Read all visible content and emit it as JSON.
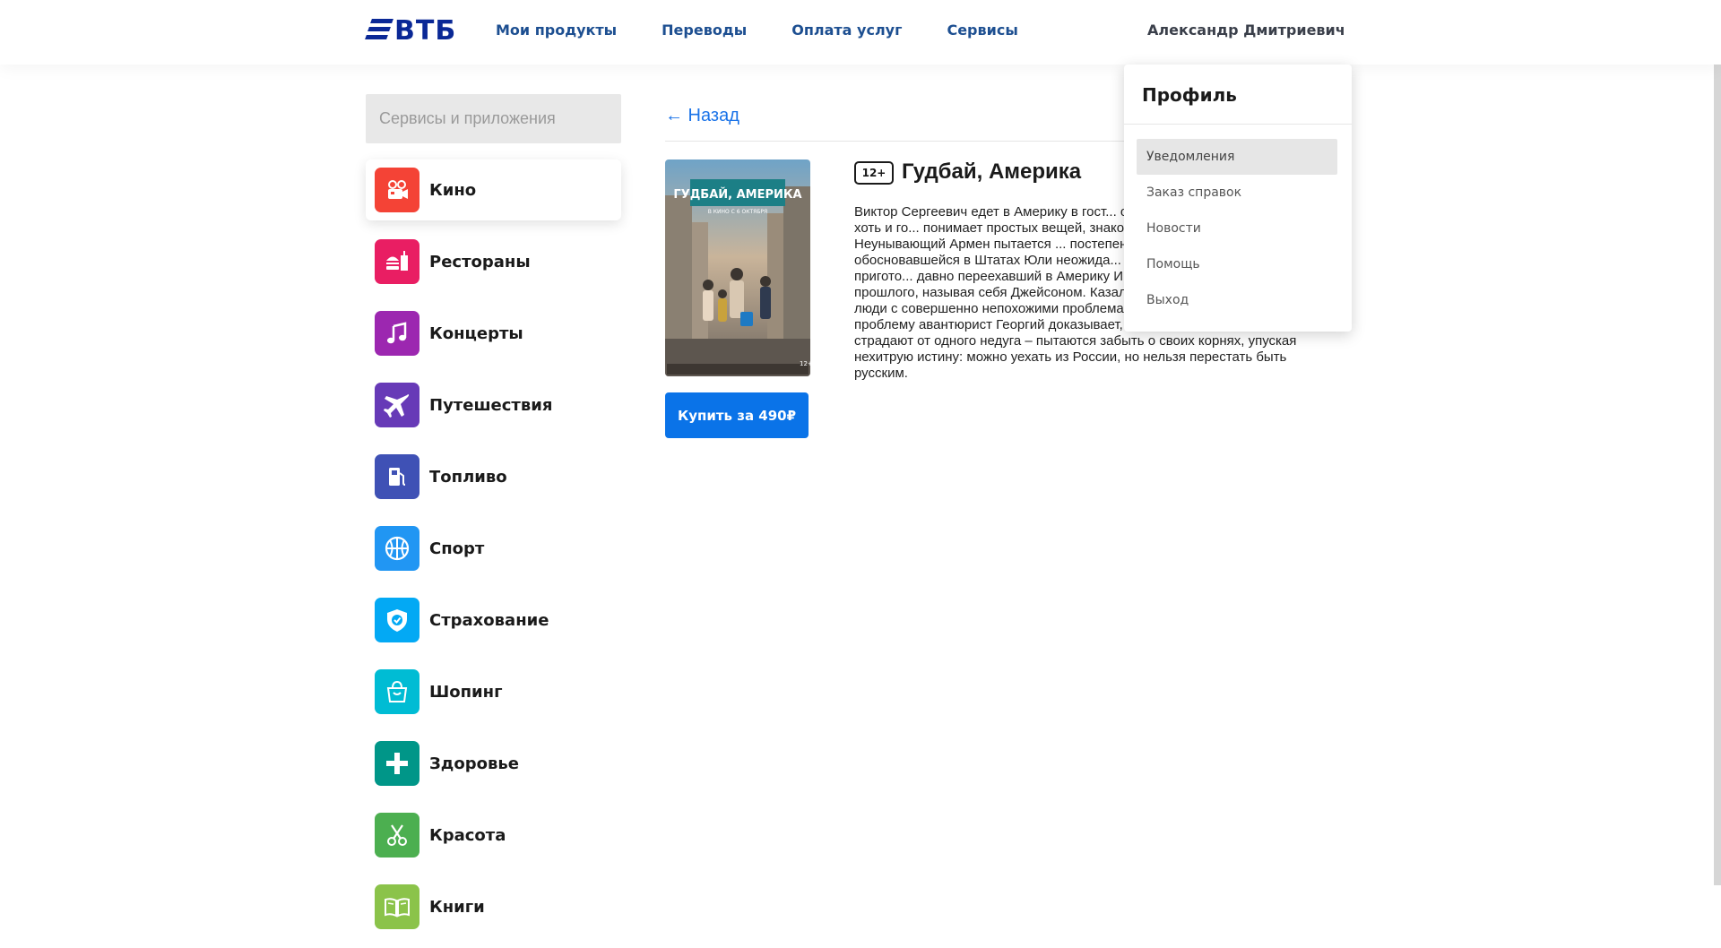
{
  "header": {
    "logo_text": "ВТБ",
    "nav": [
      "Мои продукты",
      "Переводы",
      "Оплата услуг",
      "Сервисы"
    ],
    "user_name": "Александр Дмитриевич"
  },
  "sidebar": {
    "search_placeholder": "Сервисы и приложения",
    "items": [
      {
        "label": "Кино",
        "icon": "camera-icon",
        "color": "#f44336"
      },
      {
        "label": "Рестораны",
        "icon": "burger-icon",
        "color": "#e91e63"
      },
      {
        "label": "Концерты",
        "icon": "music-note-icon",
        "color": "#9c27b0"
      },
      {
        "label": "Путешествия",
        "icon": "airplane-icon",
        "color": "#673ab7"
      },
      {
        "label": "Топливо",
        "icon": "fuel-pump-icon",
        "color": "#3f51b5"
      },
      {
        "label": "Спорт",
        "icon": "basketball-icon",
        "color": "#2196f3"
      },
      {
        "label": "Страхование",
        "icon": "shield-check-icon",
        "color": "#03a9f4"
      },
      {
        "label": "Шопинг",
        "icon": "shopping-bag-icon",
        "color": "#00bcd4"
      },
      {
        "label": "Здоровье",
        "icon": "plus-cross-icon",
        "color": "#009688"
      },
      {
        "label": "Красота",
        "icon": "scissors-icon",
        "color": "#4caf50"
      },
      {
        "label": "Книги",
        "icon": "book-icon",
        "color": "#8bc34a"
      }
    ]
  },
  "content": {
    "back_label": "← Назад",
    "age_rating": "12+",
    "title": "Гудбай, Америка",
    "buy_label": "Купить за 490₽",
    "poster": {
      "title": "ГУДБАЙ, АМЕРИКА",
      "tagline": "В КИНО С 6 ОКТЯБРЯ",
      "age": "12+"
    },
    "description": "Виктор Сергеевич едет в Америку в гост... обнаруживает, что его внук Пол хоть и го... понимает простых вещей, знакомых и по... России. Неунывающий Армен пытается ... постепенно постигая все прелести фикт... обосновавшейся в Штатах Юли неожида... невозможность найти правильно пригото... давно переехавший в Америку Игорь вс... от своего русского прошлого, называя себя Джейсоном. Казалось бы, совершенно разные люди с совершенно непохожими проблемами, но способный решить любую проблему авантюрист Георгий доказывает, что это не так, все герои страдают от одного недуга – пытаются забыть о своих корнях, упуская нехитрую истину: можно уехать из России, но нельзя перестать быть русским."
  },
  "profile_menu": {
    "title": "Профиль",
    "items": [
      "Уведомления",
      "Заказ справок",
      "Новости",
      "Помощь",
      "Выход"
    ]
  }
}
